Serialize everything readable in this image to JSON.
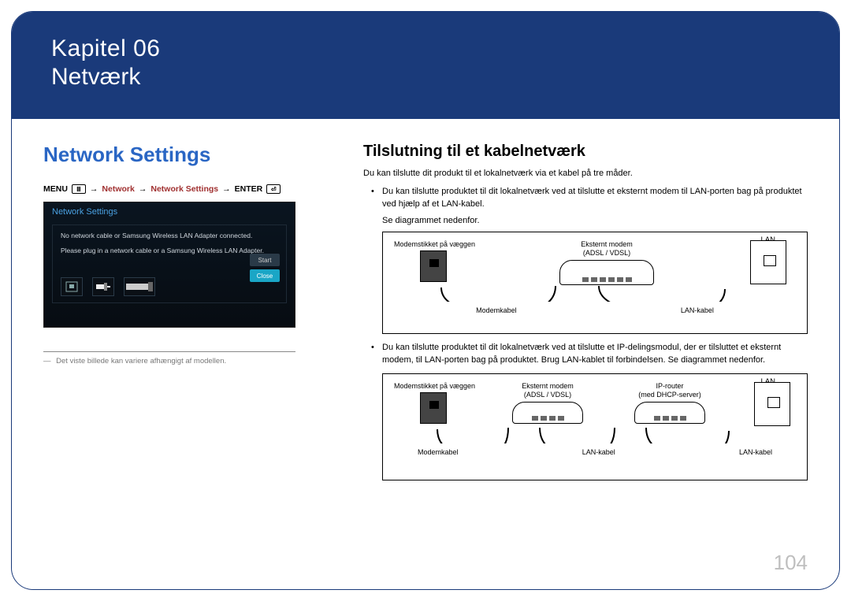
{
  "chapter": {
    "number": "Kapitel 06",
    "title": "Netværk"
  },
  "left": {
    "section_title": "Network Settings",
    "breadcrumb": {
      "menu": "MENU",
      "nav1": "Network",
      "nav2": "Network Settings",
      "enter": "ENTER"
    },
    "screenshot": {
      "title": "Network Settings",
      "msg1": "No network cable or Samsung Wireless LAN Adapter connected.",
      "msg2": "Please plug in a network cable or a Samsung Wireless LAN Adapter.",
      "start_btn": "Start",
      "close_btn": "Close"
    },
    "footnote": "Det viste billede kan variere afhængigt af modellen."
  },
  "right": {
    "title": "Tilslutning til et kabelnetværk",
    "intro": "Du kan tilslutte dit produkt til et lokalnetværk via et kabel på tre måder.",
    "bullet1": "Du kan tilslutte produktet til dit lokalnetværk ved at tilslutte et eksternt modem til LAN-porten bag på produktet ved hjælp af et LAN-kabel.",
    "sub1": "Se diagrammet nedenfor.",
    "bullet2": "Du kan tilslutte produktet til dit lokalnetværk ved at tilslutte et IP-delingsmodul, der er tilsluttet et eksternt modem, til LAN-porten bag på produktet. Brug LAN-kablet til forbindelsen. Se diagrammet nedenfor."
  },
  "diagram": {
    "lan": "LAN",
    "wall_jack": "Modemstikket på væggen",
    "external_modem": "Eksternt modem",
    "modem_type": "(ADSL / VDSL)",
    "ip_router": "IP-router",
    "ip_router_sub": "(med DHCP-server)",
    "modem_cable": "Modemkabel",
    "lan_cable": "LAN-kabel"
  },
  "page_number": "104"
}
